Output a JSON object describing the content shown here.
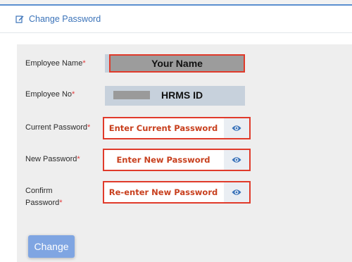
{
  "header": {
    "title": "Change Password",
    "icon": "edit-icon"
  },
  "form": {
    "employee_name": {
      "label": "Employee Name",
      "required": "*",
      "value": "Your Name"
    },
    "employee_no": {
      "label": "Employee No",
      "required": "*",
      "value": "HRMS ID"
    },
    "current_password": {
      "label": "Current Password",
      "required": "*",
      "placeholder": "Enter Current Password",
      "icon": "eye-icon"
    },
    "new_password": {
      "label": "New Password",
      "required": "*",
      "placeholder": "Enter New Password",
      "icon": "eye-icon"
    },
    "confirm_password": {
      "label_line1": "Confirm",
      "label_line2": "Password",
      "required": "*",
      "placeholder": "Re-enter New Password",
      "icon": "eye-icon"
    },
    "submit_label": "Change"
  },
  "colors": {
    "accent": "#3b73b9",
    "highlight_border": "#e03a2a",
    "button": "#7fa5e2",
    "required": "#e23b3b"
  }
}
